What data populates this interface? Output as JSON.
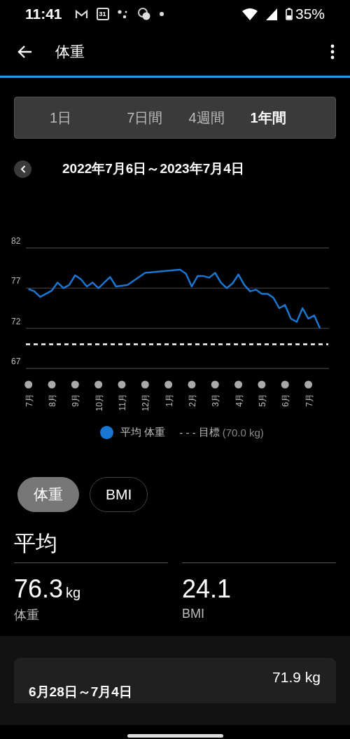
{
  "status_bar": {
    "time": "11:41",
    "calendar_day": "31",
    "battery": "35%"
  },
  "app_bar": {
    "title": "体重"
  },
  "range_tabs": [
    {
      "label": "1日",
      "selected": false
    },
    {
      "label": "7日間",
      "selected": false
    },
    {
      "label": "4週間",
      "selected": false
    },
    {
      "label": "1年間",
      "selected": true
    }
  ],
  "date_range": "2022年7月6日～2023年7月4日",
  "chart": {
    "chart_data": {
      "type": "line",
      "categories": [
        "7月",
        null,
        null,
        null,
        "8月",
        null,
        null,
        null,
        "9月",
        null,
        null,
        null,
        "10月",
        null,
        null,
        null,
        "11月",
        null,
        null,
        null,
        "12月",
        null,
        null,
        null,
        "1月",
        null,
        null,
        null,
        "2月",
        null,
        null,
        null,
        "3月",
        null,
        null,
        null,
        "4月",
        null,
        null,
        null,
        "5月",
        null,
        null,
        null,
        "6月",
        null,
        null,
        null,
        "7月",
        null,
        null
      ],
      "series": [
        {
          "name": "平均 体重",
          "color": "#1976d2",
          "values": [
            76.9,
            76.6,
            75.9,
            76.3,
            76.7,
            77.7,
            77.0,
            77.4,
            78.6,
            78.1,
            77.2,
            77.7,
            77.0,
            77.7,
            78.4,
            77.2,
            null,
            77.4,
            null,
            null,
            78.9,
            null,
            null,
            null,
            null,
            null,
            79.3,
            78.8,
            77.2,
            78.5,
            78.5,
            78.3,
            78.9,
            77.7,
            77.0,
            77.6,
            78.7,
            77.4,
            76.6,
            76.8,
            76.3,
            76.3,
            75.8,
            74.5,
            74.9,
            73.2,
            72.8,
            74.5,
            73.2,
            73.6,
            72.0
          ]
        }
      ],
      "ylim": [
        67,
        82
      ],
      "yticks": [
        67,
        72,
        77,
        82
      ],
      "ref_lines": [
        {
          "axis": "y",
          "value": 70
        }
      ]
    },
    "legend": {
      "goal_mark": "- - -",
      "goal_label": "目標",
      "goal_value": "(70.0 kg)"
    }
  },
  "metric_chips": [
    {
      "label": "体重",
      "selected": true
    },
    {
      "label": "BMI",
      "selected": false
    }
  ],
  "summary": {
    "heading": "平均",
    "stats": [
      {
        "value": "76.3",
        "unit": "kg",
        "label": "体重"
      },
      {
        "value": "24.1",
        "label": "BMI"
      }
    ]
  },
  "week_card": {
    "range": "6月28日～7月4日",
    "value": "71.9 kg"
  }
}
